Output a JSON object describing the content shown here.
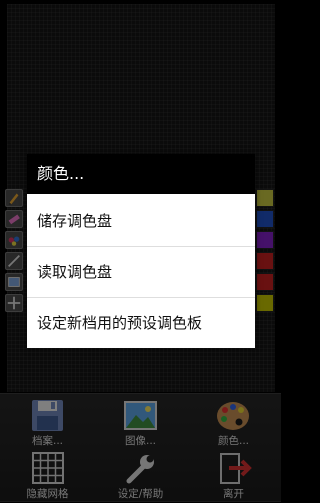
{
  "context_menu": {
    "title": "颜色...",
    "items": [
      {
        "label": "储存调色盘"
      },
      {
        "label": "读取调色盘"
      },
      {
        "label": "设定新档用的预设调色板"
      }
    ]
  },
  "toolbar": {
    "file": {
      "label": "档案...",
      "icon": "floppy-disk-icon"
    },
    "image": {
      "label": "图像...",
      "icon": "picture-icon"
    },
    "color": {
      "label": "颜色...",
      "icon": "palette-icon"
    },
    "grid": {
      "label": "隐藏网格",
      "icon": "grid-icon"
    },
    "settings": {
      "label": "设定/帮助",
      "icon": "wrench-icon"
    },
    "exit": {
      "label": "离开",
      "icon": "exit-icon"
    }
  },
  "side_tools": [
    "pencil-icon",
    "eraser-icon",
    "fill-icon",
    "line-icon",
    "rectangle-icon",
    "move-icon"
  ],
  "palette_colors": [
    "#bfbf3f",
    "#1f4fbf",
    "#7f1fbf",
    "#bf1f1f",
    "#bf1f1f",
    "#bfbf00"
  ],
  "colors": {
    "menu_title_bg": "#000000",
    "menu_bg": "#ffffff",
    "background": "#000000"
  }
}
